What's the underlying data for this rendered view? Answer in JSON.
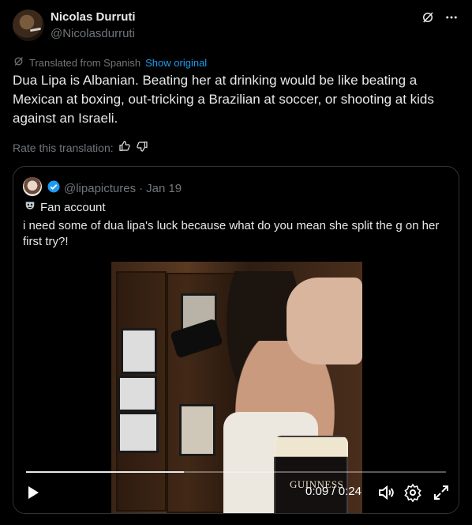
{
  "author": {
    "name": "Nicolas Durruti",
    "handle": "@Nicolasdurruti"
  },
  "translation": {
    "label": "Translated from Spanish",
    "show_original": "Show original",
    "rate_label": "Rate this translation:"
  },
  "tweet": {
    "text": "Dua Lipa is Albanian. Beating her at drinking would be like beating a Mexican at boxing, out-tricking a Brazilian at soccer, or shooting at kids against an Israeli."
  },
  "quote": {
    "handle": "@lipapictures",
    "separator": "·",
    "date": "Jan 19",
    "fan_label": "Fan account",
    "text": "i need some of dua lipa's luck because what do you mean she split the g on her first try?!",
    "video": {
      "brand_text": "GUINNESS",
      "current_time": "0:09",
      "time_separator": "/",
      "duration": "0:24",
      "progress_fraction": 0.375
    }
  },
  "colors": {
    "background": "#000000",
    "text": "#e7e9ea",
    "secondary": "#71767b",
    "link": "#1d9bf0",
    "verified": "#1d9bf0",
    "border": "#2f3336"
  },
  "icons": [
    "grok-icon",
    "more-icon",
    "translate-icon",
    "thumbs-up-icon",
    "thumbs-down-icon",
    "verified-badge-icon",
    "fan-mask-icon",
    "play-icon",
    "volume-icon",
    "settings-icon",
    "fullscreen-icon"
  ]
}
